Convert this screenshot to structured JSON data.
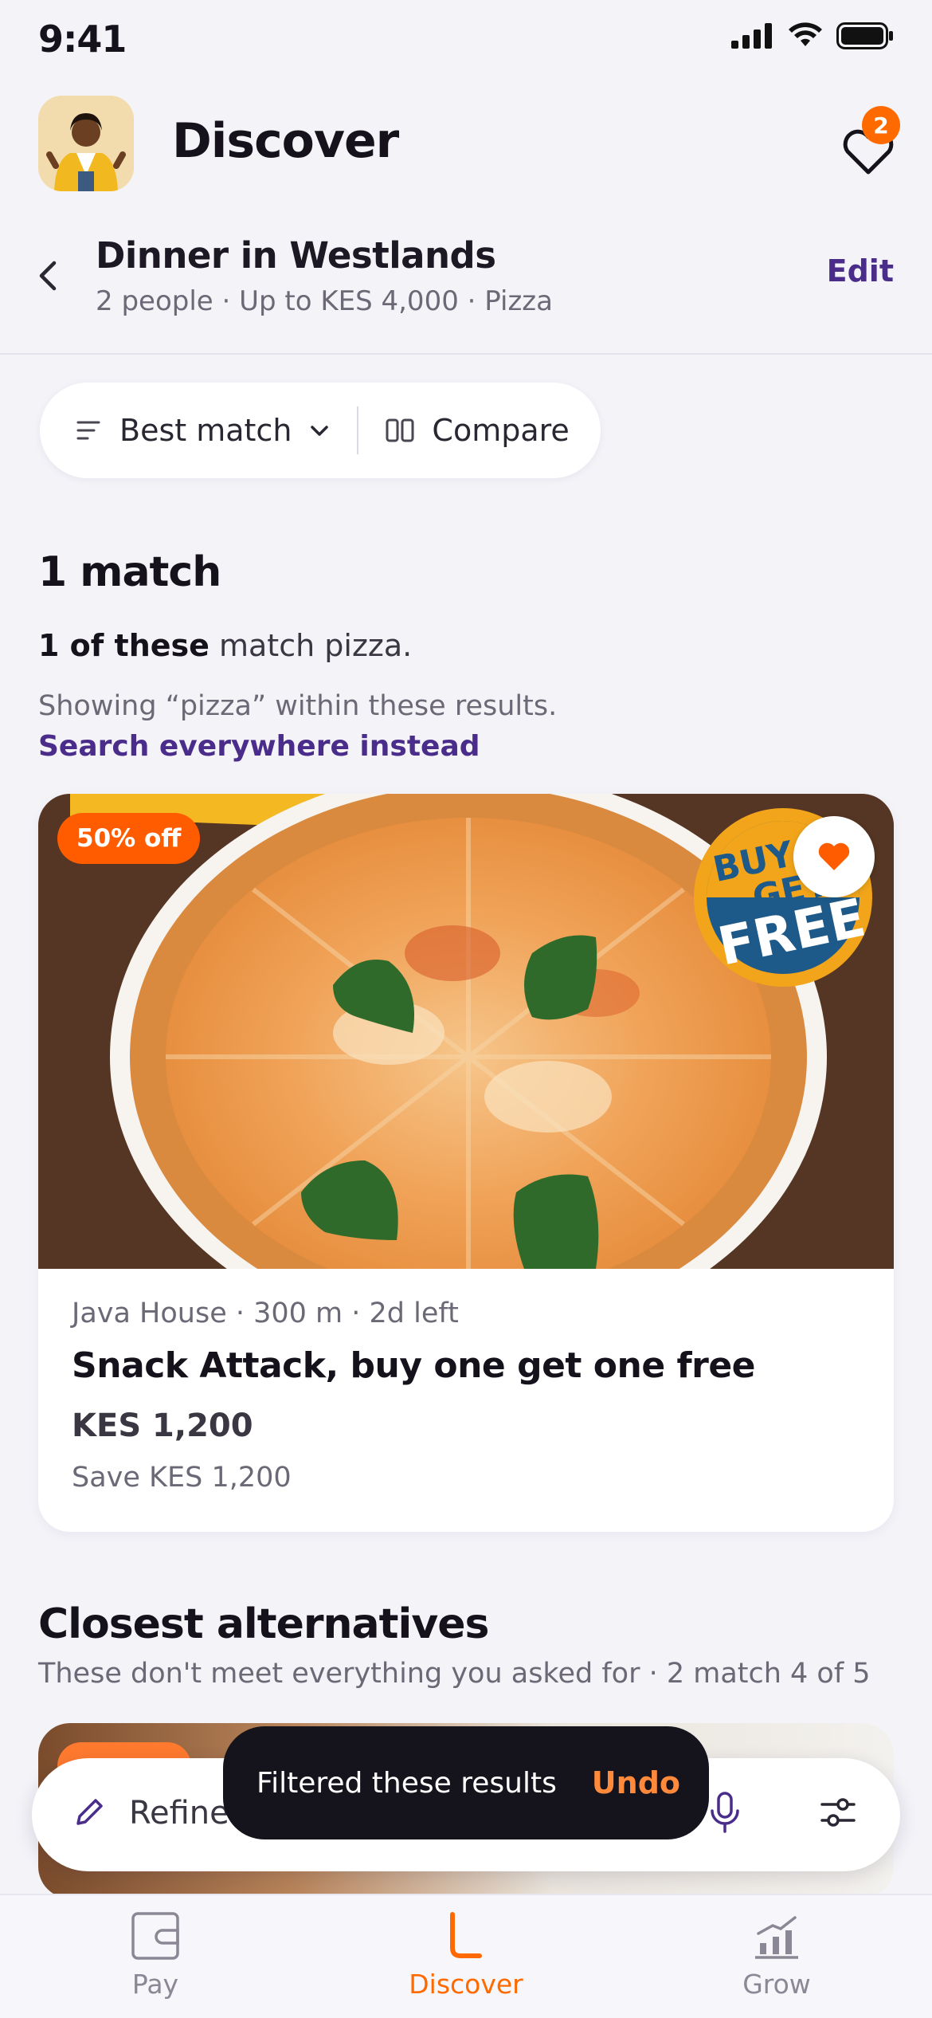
{
  "status": {
    "time": "9:41"
  },
  "header": {
    "title": "Discover",
    "favorites_count": "2"
  },
  "context": {
    "title": "Dinner in Westlands",
    "subtitle": "2 people · Up to KES 4,000 · Pizza",
    "edit_label": "Edit"
  },
  "toolbar": {
    "sort_label": "Best match",
    "compare_label": "Compare"
  },
  "results": {
    "count_title": "1 match",
    "note_bold": "1 of these",
    "note_rest": " match pizza.",
    "showing_text": "Showing “pizza” within these results.",
    "search_everywhere": "Search everywhere instead"
  },
  "deal": {
    "badge": "50% off",
    "meta": "Java House · 300 m · 2d left",
    "title": "Snack Attack, buy one get one free",
    "price": "KES 1,200",
    "save": "Save KES 1,200",
    "image_text": {
      "sticker_line1": "BUY 1",
      "sticker_line2": "GET",
      "sticker_line3": "FREE"
    }
  },
  "alternatives": {
    "title": "Closest alternatives",
    "subtitle": "These don't meet everything you asked for · 2 match 4 of 5"
  },
  "refine": {
    "label": "Refine"
  },
  "toast": {
    "message": "Filtered these results",
    "action": "Undo"
  },
  "tabs": [
    {
      "label": "Pay",
      "icon": "wallet-icon"
    },
    {
      "label": "Discover",
      "icon": "discover-icon",
      "active": true
    },
    {
      "label": "Grow",
      "icon": "growth-chart-icon"
    }
  ],
  "colors": {
    "accent": "#ff6a00",
    "brand_purple": "#4a2d8a",
    "toast_bg": "#15131c"
  }
}
